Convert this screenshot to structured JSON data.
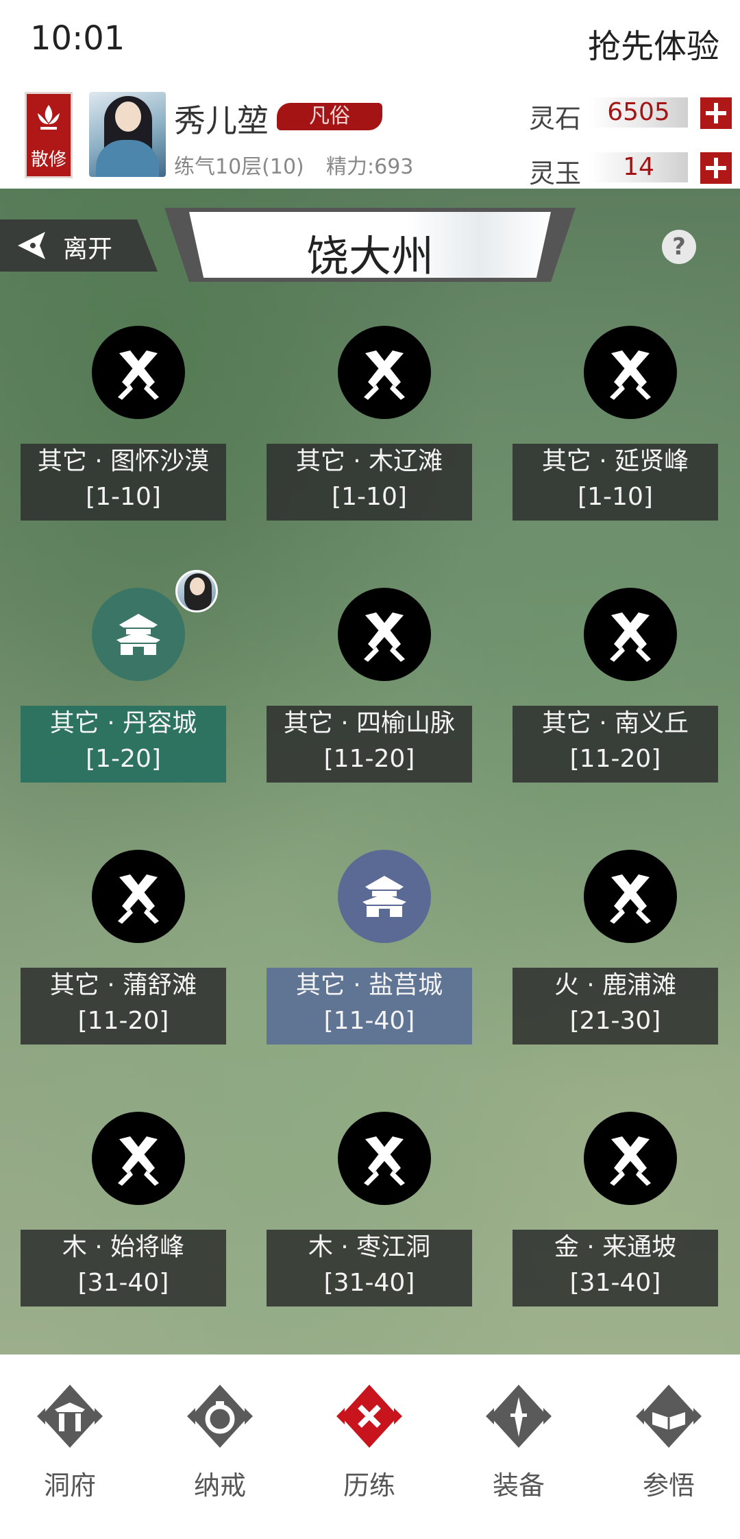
{
  "status": {
    "time": "10:01",
    "early_access": "抢先体验"
  },
  "player": {
    "badge": "散修",
    "name": "秀儿堃",
    "rank": "凡俗",
    "level": "练气10层(10)",
    "energy": "精力:693"
  },
  "resources": [
    {
      "label": "灵石",
      "value": "6505"
    },
    {
      "label": "灵玉",
      "value": "14"
    }
  ],
  "map": {
    "leave_label": "离开",
    "title": "饶大州",
    "help": "?"
  },
  "locations": [
    {
      "name": "其它 · 图怀沙漠",
      "range": "[1-10]",
      "type": "battle"
    },
    {
      "name": "其它 · 木辽滩",
      "range": "[1-10]",
      "type": "battle"
    },
    {
      "name": "其它 · 延贤峰",
      "range": "[1-10]",
      "type": "battle"
    },
    {
      "name": "其它 · 丹容城",
      "range": "[1-20]",
      "type": "city-green"
    },
    {
      "name": "其它 · 四榆山脉",
      "range": "[11-20]",
      "type": "battle"
    },
    {
      "name": "其它 · 南义丘",
      "range": "[11-20]",
      "type": "battle"
    },
    {
      "name": "其它 · 蒲舒滩",
      "range": "[11-20]",
      "type": "battle"
    },
    {
      "name": "其它 · 盐莒城",
      "range": "[11-40]",
      "type": "city-blue"
    },
    {
      "name": "火 · 鹿浦滩",
      "range": "[21-30]",
      "type": "battle"
    },
    {
      "name": "木 · 始将峰",
      "range": "[31-40]",
      "type": "battle"
    },
    {
      "name": "木 · 枣江洞",
      "range": "[31-40]",
      "type": "battle"
    },
    {
      "name": "金 · 来通坡",
      "range": "[31-40]",
      "type": "battle"
    }
  ],
  "nav": [
    {
      "label": "洞府",
      "icon": "cave-gate-icon"
    },
    {
      "label": "纳戒",
      "icon": "ring-icon"
    },
    {
      "label": "历练",
      "icon": "crossed-swords-icon",
      "active": true
    },
    {
      "label": "装备",
      "icon": "sword-icon"
    },
    {
      "label": "参悟",
      "icon": "open-book-icon"
    }
  ],
  "colors": {
    "accent_red": "#b01818",
    "city_green": "#3a7566",
    "city_blue": "#5b6a95"
  }
}
